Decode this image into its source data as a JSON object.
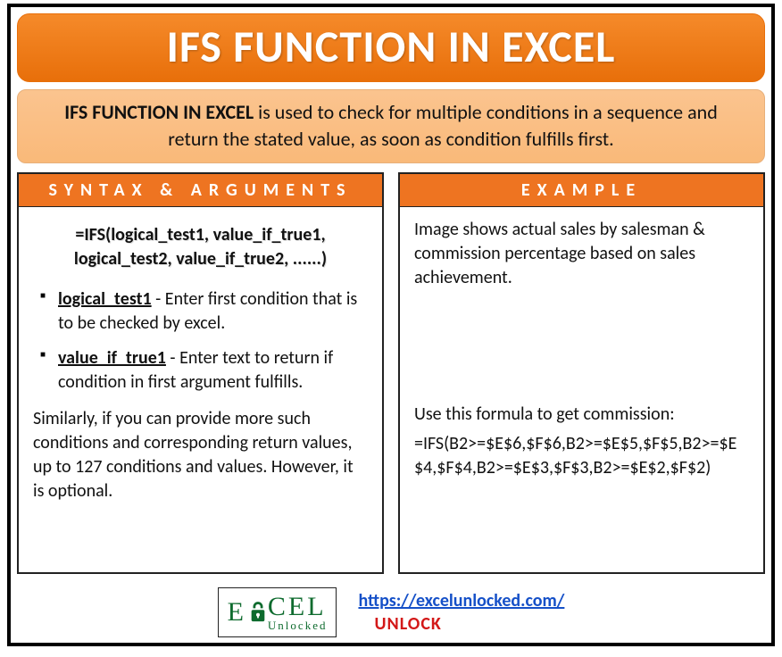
{
  "title": "IFS FUNCTION IN EXCEL",
  "description": {
    "lead": "IFS FUNCTION IN EXCEL",
    "rest": " is used to check for multiple conditions in a sequence and return the stated value, as soon as condition fulfills first."
  },
  "syntax": {
    "header": "SYNTAX & ARGUMENTS",
    "formula": "=IFS(logical_test1, value_if_true1, logical_test2, value_if_true2, ......)",
    "args": [
      {
        "name": "logical_test1",
        "desc": " - Enter first condition that is to be checked by excel."
      },
      {
        "name": "value_if_true1",
        "desc": " - Enter text to return if condition in first argument fulfills."
      }
    ],
    "note": "Similarly, if you can provide more such conditions and corresponding return values, up to 127 conditions and values. However, it is optional."
  },
  "example": {
    "header": "EXAMPLE",
    "intro": "Image shows actual sales by salesman & commission percentage based on sales achievement.",
    "formula_label": "Use this formula to get commission:",
    "formula": "=IFS(B2>=$E$6,$F$6,B2>=$E$5,$F$5,B2>=$E$4,$F$4,B2>=$E$3,$F$3,B2>=$E$2,$F$2)"
  },
  "footer": {
    "logo_pre": "E",
    "logo_post": "CEL",
    "logo_sub": "Unlocked",
    "url": "https://excelunlocked.com/",
    "unlock": "UNLOCK"
  }
}
